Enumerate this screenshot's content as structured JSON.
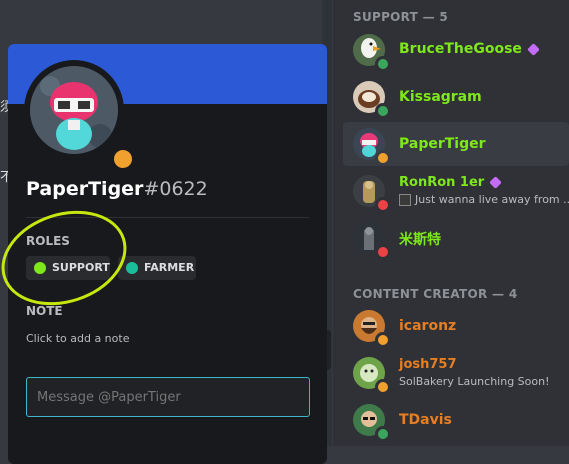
{
  "background_chars": [
    "须",
    "不"
  ],
  "popout": {
    "username": "PaperTiger",
    "discriminator": "#0622",
    "roles_label": "ROLES",
    "roles": [
      {
        "name": "SUPPORT",
        "color": "#7ee81a"
      },
      {
        "name": "FARMER",
        "color": "#1abc9c"
      }
    ],
    "note_label": "NOTE",
    "note_placeholder": "Click to add a note",
    "message_placeholder": "Message @PaperTiger",
    "banner_color": "#2c59d6",
    "status_color": "#f0a02f"
  },
  "members": {
    "support_header": "SUPPORT — 5",
    "support": [
      {
        "name": "BruceTheGoose",
        "color": "#7ee81a",
        "status_color": "#3ba55d",
        "boost": true,
        "icon": "goose-avatar"
      },
      {
        "name": "Kissagram",
        "color": "#7ee81a",
        "status_color": "#3ba55d",
        "boost": false,
        "icon": "coffee-avatar"
      },
      {
        "name": "PaperTiger",
        "color": "#7ee81a",
        "status_color": "#f0a02f",
        "boost": false,
        "icon": "tiger-avatar"
      },
      {
        "name": "RonRon 1er",
        "color": "#7ee81a",
        "status_color": "#ed4245",
        "boost": true,
        "status_text": "Just wanna live away from ...",
        "icon": "statue-avatar"
      },
      {
        "name": "米斯特",
        "color": "#7ee81a",
        "status_color": "#ed4245",
        "boost": false,
        "icon": "figure-avatar"
      }
    ],
    "creator_header": "CONTENT CREATOR — 4",
    "creators": [
      {
        "name": "icaronz",
        "color": "#e67e22",
        "status_color": "#f0a02f",
        "icon": "bearded-avatar"
      },
      {
        "name": "josh757",
        "color": "#e67e22",
        "status_color": "#f0a02f",
        "status_text": "SolBakery Launching Soon!",
        "icon": "cartoon-avatar"
      },
      {
        "name": "TDavis",
        "color": "#e67e22",
        "status_color": "#3ba55d",
        "icon": "glasses-avatar"
      }
    ]
  }
}
